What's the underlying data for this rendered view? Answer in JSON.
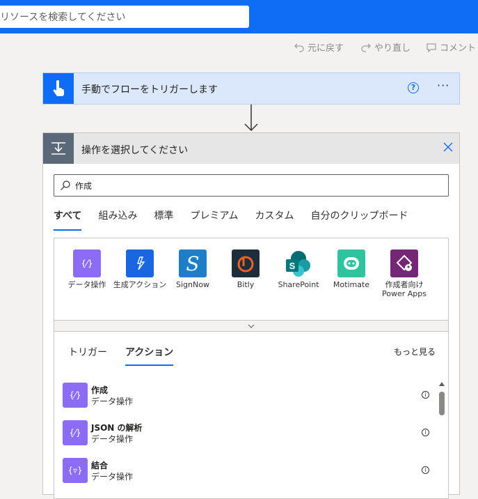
{
  "header": {
    "search_placeholder": "リソースを検索してください"
  },
  "commands": {
    "undo": "元に戻す",
    "redo": "やり直し",
    "comment": "コメント"
  },
  "trigger": {
    "title": "手動でフローをトリガーします"
  },
  "action_picker": {
    "title": "操作を選択してください",
    "search_value": "作成",
    "tabs": [
      "すべて",
      "組み込み",
      "標準",
      "プレミアム",
      "カスタム",
      "自分のクリップボード"
    ],
    "connectors": [
      {
        "label": "データ操作",
        "icon": "data-operation-icon",
        "color": "#8c6cf5"
      },
      {
        "label": "生成アクション",
        "icon": "ai-sparkle-icon",
        "color": "#1a66e0"
      },
      {
        "label": "SignNow",
        "icon": "signnow-icon",
        "color": "#1e7fc8"
      },
      {
        "label": "Bitly",
        "icon": "bitly-icon",
        "color": "#1d2d3c"
      },
      {
        "label": "SharePoint",
        "icon": "sharepoint-icon",
        "color": "#0b7a70"
      },
      {
        "label": "Motimate",
        "icon": "motimate-icon",
        "color": "#2ec4a0"
      },
      {
        "label": "作成者向け Power Apps",
        "icon": "power-apps-icon",
        "color": "#742774"
      }
    ],
    "subtabs": [
      "トリガー",
      "アクション"
    ],
    "see_more": "もっと見る",
    "actions": [
      {
        "name": "作成",
        "connector": "データ操作"
      },
      {
        "name": "JSON の解析",
        "connector": "データ操作"
      },
      {
        "name": "結合",
        "connector": "データ操作"
      }
    ]
  }
}
